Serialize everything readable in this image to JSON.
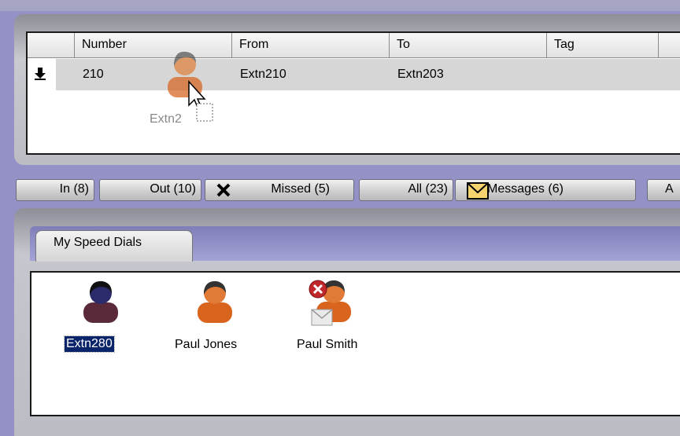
{
  "calls": {
    "columns": [
      "Number",
      "From",
      "To",
      "Tag"
    ],
    "rows": [
      {
        "direction_icon": "incoming-arrow-icon",
        "number": "210",
        "from": "Extn210",
        "to": "Extn203",
        "tag": ""
      }
    ]
  },
  "drag": {
    "label": "Extn2"
  },
  "tabs": {
    "in": "In (8)",
    "out": "Out (10)",
    "missed": "Missed (5)",
    "all": "All (23)",
    "messages": "Messages (6)",
    "more": "A"
  },
  "speed_dials": {
    "tab_label": "My Speed Dials",
    "items": [
      {
        "label": "Extn280",
        "icon": "contact-dark-icon",
        "selected": true
      },
      {
        "label": "Paul Jones",
        "icon": "contact-icon",
        "selected": false
      },
      {
        "label": "Paul Smith",
        "icon": "contact-busy-message-icon",
        "selected": false
      }
    ]
  },
  "colors": {
    "background": "#9491c6",
    "selection": "#0a246a",
    "contact_orange": "#d8641e"
  }
}
